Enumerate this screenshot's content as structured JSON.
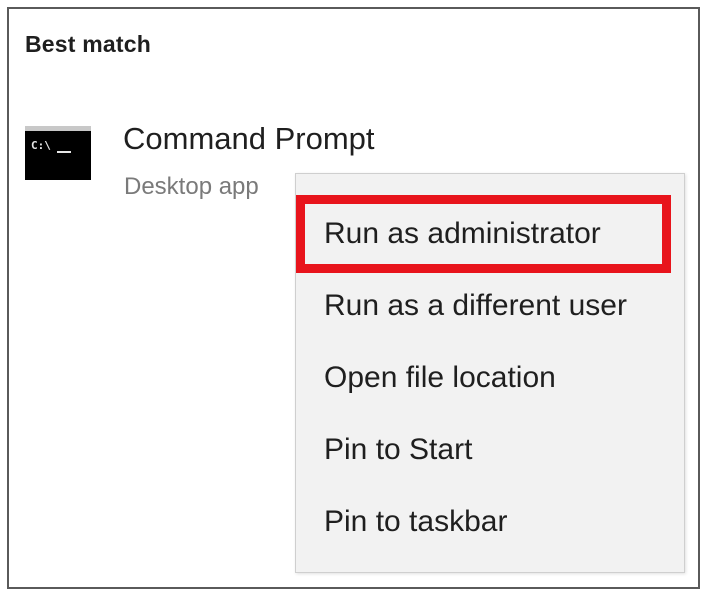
{
  "section": {
    "title": "Best match"
  },
  "app": {
    "name": "Command Prompt",
    "type": "Desktop app",
    "icon": "command-prompt-icon",
    "icon_text": "C:\\"
  },
  "context_menu": {
    "items": [
      {
        "label": "Run as administrator",
        "highlighted": true
      },
      {
        "label": "Run as a different user",
        "highlighted": false
      },
      {
        "label": "Open file location",
        "highlighted": false
      },
      {
        "label": "Pin to Start",
        "highlighted": false
      },
      {
        "label": "Pin to taskbar",
        "highlighted": false
      }
    ]
  },
  "colors": {
    "highlight": "#e8141c",
    "menu_background": "#f2f2f2",
    "secondary_text": "#7a7a7a"
  }
}
